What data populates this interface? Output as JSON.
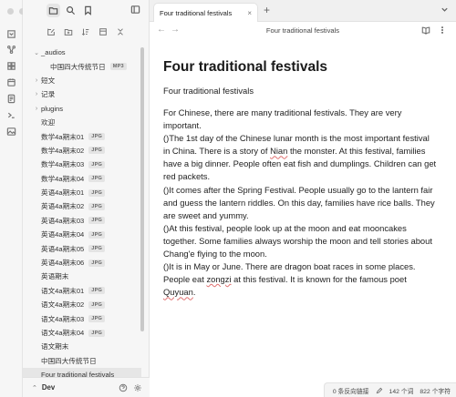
{
  "sidebar": {
    "tree": [
      {
        "type": "folder",
        "open": true,
        "label": "_audios"
      },
      {
        "type": "file",
        "level": 1,
        "label": "中国四大传统节日",
        "badge": "MP3"
      },
      {
        "type": "folder",
        "open": false,
        "label": "短文"
      },
      {
        "type": "folder",
        "open": false,
        "label": "记录"
      },
      {
        "type": "folder",
        "open": false,
        "label": "plugins"
      },
      {
        "type": "file",
        "level": 0,
        "label": "欢迎"
      },
      {
        "type": "file",
        "level": 0,
        "label": "数学4a期末01",
        "badge": "JPG"
      },
      {
        "type": "file",
        "level": 0,
        "label": "数学4a期末02",
        "badge": "JPG"
      },
      {
        "type": "file",
        "level": 0,
        "label": "数学4a期末03",
        "badge": "JPG"
      },
      {
        "type": "file",
        "level": 0,
        "label": "数学4a期末04",
        "badge": "JPG"
      },
      {
        "type": "file",
        "level": 0,
        "label": "英语4a期末01",
        "badge": "JPG"
      },
      {
        "type": "file",
        "level": 0,
        "label": "英语4a期末02",
        "badge": "JPG"
      },
      {
        "type": "file",
        "level": 0,
        "label": "英语4a期末03",
        "badge": "JPG"
      },
      {
        "type": "file",
        "level": 0,
        "label": "英语4a期末04",
        "badge": "JPG"
      },
      {
        "type": "file",
        "level": 0,
        "label": "英语4a期末05",
        "badge": "JPG"
      },
      {
        "type": "file",
        "level": 0,
        "label": "英语4a期末06",
        "badge": "JPG"
      },
      {
        "type": "file",
        "level": 0,
        "label": "英语期末"
      },
      {
        "type": "file",
        "level": 0,
        "label": "语文4a期末01",
        "badge": "JPG"
      },
      {
        "type": "file",
        "level": 0,
        "label": "语文4a期末02",
        "badge": "JPG"
      },
      {
        "type": "file",
        "level": 0,
        "label": "语文4a期末03",
        "badge": "JPG"
      },
      {
        "type": "file",
        "level": 0,
        "label": "语文4a期末04",
        "badge": "JPG"
      },
      {
        "type": "file",
        "level": 0,
        "label": "语文期末"
      },
      {
        "type": "file",
        "level": 0,
        "label": "中国四大传统节日"
      },
      {
        "type": "file",
        "level": 0,
        "label": "Four traditional festivals",
        "selected": true
      }
    ],
    "vault_name": "Dev"
  },
  "tab": {
    "label": "Four traditional festivals",
    "close": "×",
    "new": "+"
  },
  "nav": {
    "back": "←",
    "forward": "→",
    "title": "Four traditional festivals"
  },
  "doc": {
    "title": "Four traditional festivals",
    "subtitle": "Four traditional festivals",
    "p1": "For Chinese, there are many traditional festivals. They are very important.",
    "p2a": "()The 1st day of the Chinese lunar month is the most important festival in China. There is a story of ",
    "p2b": "Nian",
    "p2c": " the monster. At this festival, families have a big dinner. People often eat fish and dumplings. Children can get red packets.",
    "p3": "()It comes after the Spring Festival. People usually go to the lantern fair and guess the lantern riddles. On this day, families have rice balls. They are sweet and yummy.",
    "p4": "()At this festival, people look up at the moon and eat mooncakes together. Some families always worship the moon and tell stories about Chang'e flying to the moon.",
    "p5a": "()It is in May or June. There are dragon boat races in some places. People eat ",
    "p5b": "zongzi",
    "p5c": " at this festival. It is known for the famous poet ",
    "p5d": "Quyuan",
    "p5e": "."
  },
  "status": {
    "backlinks": "0 条反向链接",
    "words": "142 个词",
    "chars": "822 个字符"
  }
}
